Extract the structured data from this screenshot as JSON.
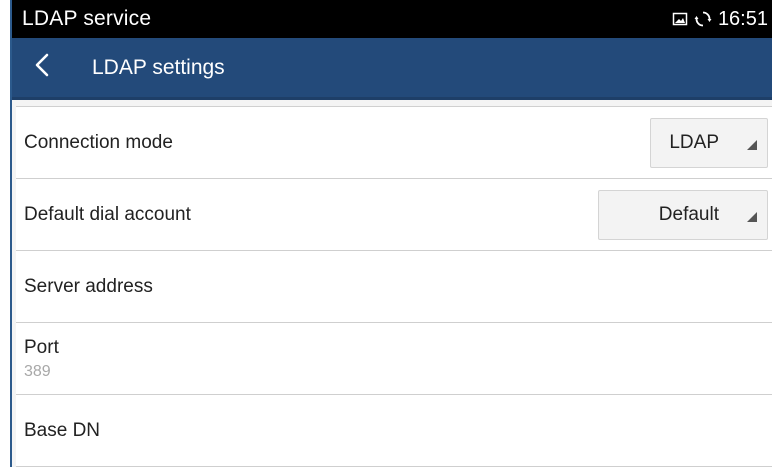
{
  "status_bar": {
    "app_name": "LDAP service",
    "time": "16:51",
    "icons": [
      "screenshot-icon",
      "sync-icon"
    ]
  },
  "app_bar": {
    "title": "LDAP settings",
    "back_icon": "chevron-left-icon"
  },
  "colors": {
    "status_bar_bg": "#000000",
    "app_bar_bg": "#234a7a",
    "secondary_text": "#a8a8a8"
  },
  "settings": {
    "connection_mode": {
      "label": "Connection mode",
      "value": "LDAP"
    },
    "default_dial_account": {
      "label": "Default dial account",
      "value": "Default"
    },
    "server_address": {
      "label": "Server address"
    },
    "port": {
      "label": "Port",
      "value": "389"
    },
    "base_dn": {
      "label": "Base DN"
    }
  }
}
